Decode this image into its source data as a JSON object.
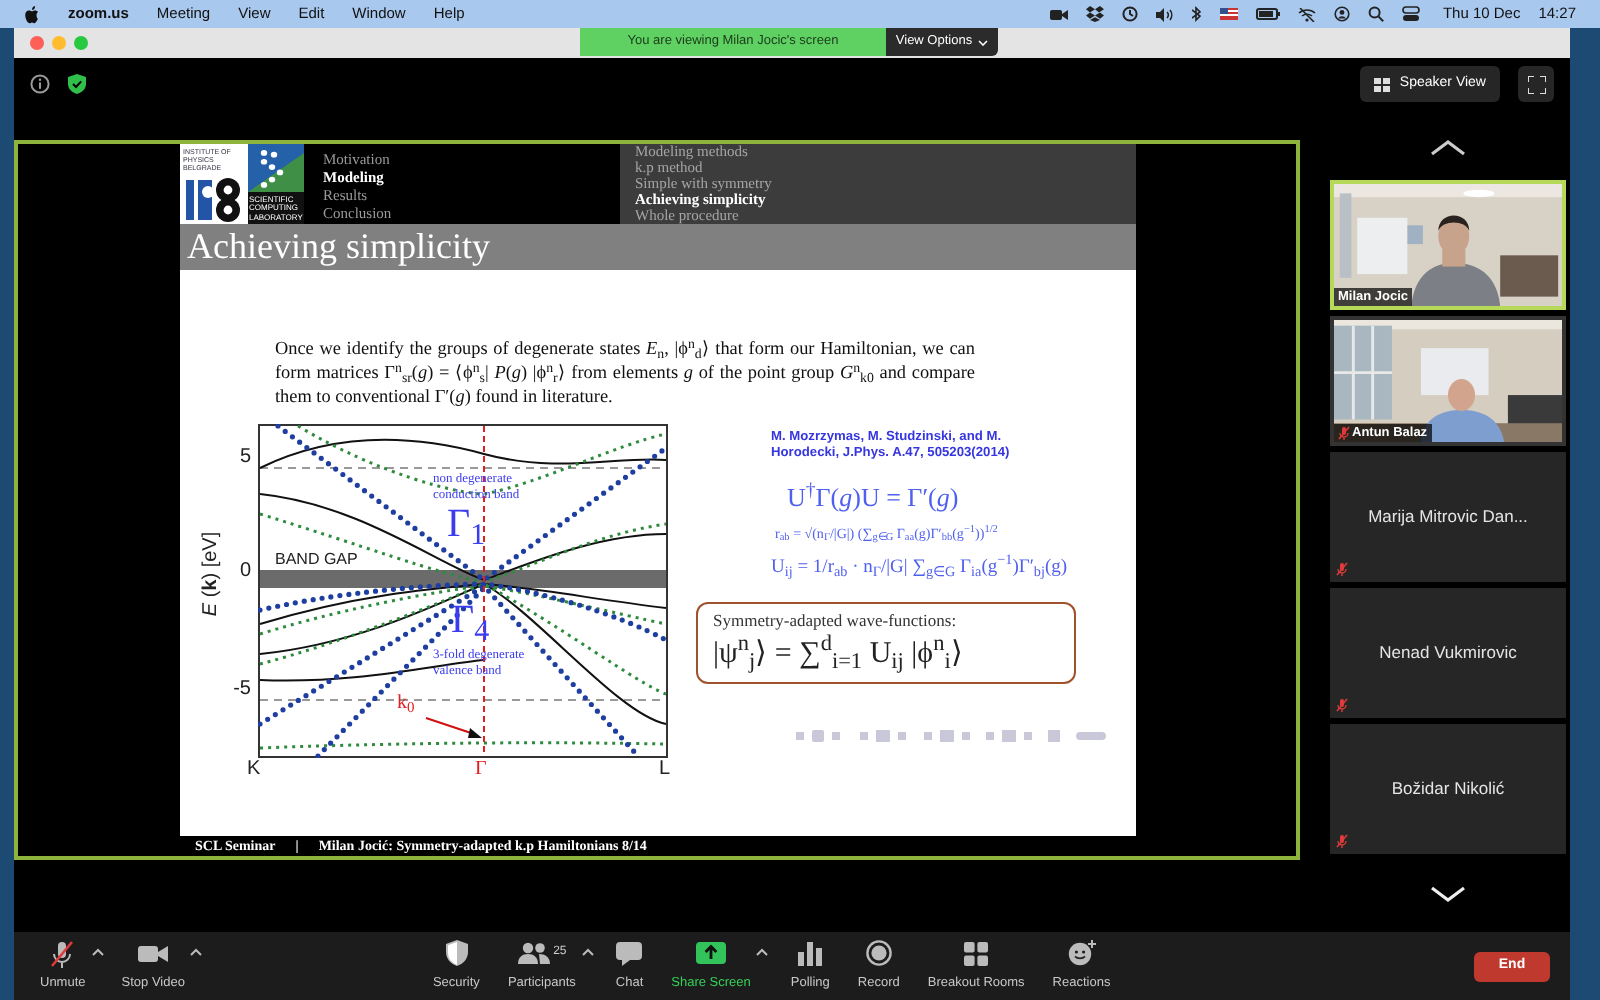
{
  "menu_bar": {
    "app": "zoom.us",
    "menus": [
      "Meeting",
      "View",
      "Edit",
      "Window",
      "Help"
    ],
    "date": "Thu 10 Dec",
    "time": "14:27"
  },
  "share_banner": {
    "text": "You are viewing Milan Jocic's screen",
    "button": "View Options"
  },
  "view_button": "Speaker View",
  "slide": {
    "logos": [
      {
        "caption": "INSTITUTE OF PHYSICS BELGRADE"
      },
      {
        "caption": "SCIENTIFIC COMPUTING LABORATORY"
      }
    ],
    "sections": [
      {
        "label": "Motivation",
        "selected": false
      },
      {
        "label": "Modeling",
        "selected": true
      },
      {
        "label": "Results",
        "selected": false
      },
      {
        "label": "Conclusion",
        "selected": false
      }
    ],
    "subsections": [
      {
        "label": "Modeling methods",
        "selected": false
      },
      {
        "label": "k.p method",
        "selected": false
      },
      {
        "label": "Simple with symmetry",
        "selected": false
      },
      {
        "label": "Achieving simplicity",
        "selected": true
      },
      {
        "label": "Whole procedure",
        "selected": false
      }
    ],
    "title": "Achieving simplicity",
    "paragraph": "Once we identify the groups of degenerate states *E*$_{n}$, |ϕ$^{n}$$_{d}$⟩ that form our Hamiltonian, we can form matrices Γ$^{n}$$_{sr}$(*g*) = ⟨ϕ$^{n}$$_{s}$| *P*(*g*) |ϕ$^{n}$$_{r}$⟩ from elements *g* of the point group *G*$^{n}$$_{k0}$ and compare them to conventional Γ′(*g*) found in literature.",
    "plot": {
      "y_label": "*E* (**k**) [eV]",
      "y_ticks": [
        "5",
        "0",
        "-5"
      ],
      "x_ticks": [
        "K",
        "Γ",
        "L"
      ],
      "annotations": [
        {
          "kind": "label",
          "text": "BAND GAP"
        },
        {
          "kind": "note",
          "text": "non degenerate conduction band"
        },
        {
          "kind": "symbol",
          "text": "Γ$_{1}$"
        },
        {
          "kind": "symbol",
          "text": "Γ$_{4}$"
        },
        {
          "kind": "note",
          "text": "3-fold degenerate valence band"
        },
        {
          "kind": "point",
          "text": "k$_{0}$"
        }
      ]
    },
    "reference": "M. Mozrzymas,   M. Studzinski,   and M.   Horodecki, J.Phys. A.47, 505203(2014)",
    "equations": [
      "U$^{†}$Γ(*g*)U = Γ′(*g*)",
      "r$_{ab}$ = √(n$_{Γ}$/|G|) (∑$_{g∈G}$ Γ$_{aa}$(g)Γ′$_{bb}$(g$^{−1}$))$^{1/2}$",
      "U$_{ij}$ = 1/r$_{ab}$ · n$_{Γ}$/|G| ∑$_{g∈G}$ Γ$_{ia}$(g$^{−1}$)Γ′$_{bj}$(g)"
    ],
    "box": {
      "title": "Symmetry-adapted wave-functions:",
      "equation": "|ψ$^{n}$$_{j}$⟩ = ∑$^{d}$$_{i=1}$ U$_{ij}$ |ϕ$^{n}$$_{i}$⟩"
    },
    "footer": [
      "SCL Seminar",
      "|",
      "Milan Jocić:  Symmetry-adapted k.p Hamiltonians 8/14"
    ]
  },
  "participants": [
    {
      "name": "Milan Jocic",
      "kind": "video",
      "muted": false,
      "speaking": true
    },
    {
      "name": "Antun Balaz",
      "kind": "video",
      "muted": true,
      "speaking": false
    },
    {
      "name": "Marija Mitrovic Dan...",
      "kind": "name",
      "muted": true,
      "speaking": false
    },
    {
      "name": "Nenad Vukmirovic",
      "kind": "name",
      "muted": true,
      "speaking": false
    },
    {
      "name": "Božidar Nikolić",
      "kind": "name",
      "muted": true,
      "speaking": false
    }
  ],
  "toolbar": [
    {
      "label": "Unmute",
      "kind": "mic_muted",
      "caret": true,
      "highlighted": false
    },
    {
      "label": "Stop Video",
      "kind": "camera",
      "caret": true,
      "highlighted": false
    },
    {
      "label": "Security",
      "kind": "shield",
      "caret": false,
      "highlighted": false
    },
    {
      "label": "Participants",
      "kind": "people",
      "count": "25",
      "caret": true,
      "highlighted": false
    },
    {
      "label": "Chat",
      "kind": "chat",
      "caret": false,
      "highlighted": false
    },
    {
      "label": "Share Screen",
      "kind": "share",
      "caret": true,
      "highlighted": true
    },
    {
      "label": "Polling",
      "kind": "poll",
      "caret": false,
      "highlighted": false
    },
    {
      "label": "Record",
      "kind": "record",
      "caret": false,
      "highlighted": false
    },
    {
      "label": "Breakout Rooms",
      "kind": "grid",
      "caret": false,
      "highlighted": false
    },
    {
      "label": "Reactions",
      "kind": "emoji",
      "caret": false,
      "highlighted": false
    }
  ],
  "end_button": "End"
}
